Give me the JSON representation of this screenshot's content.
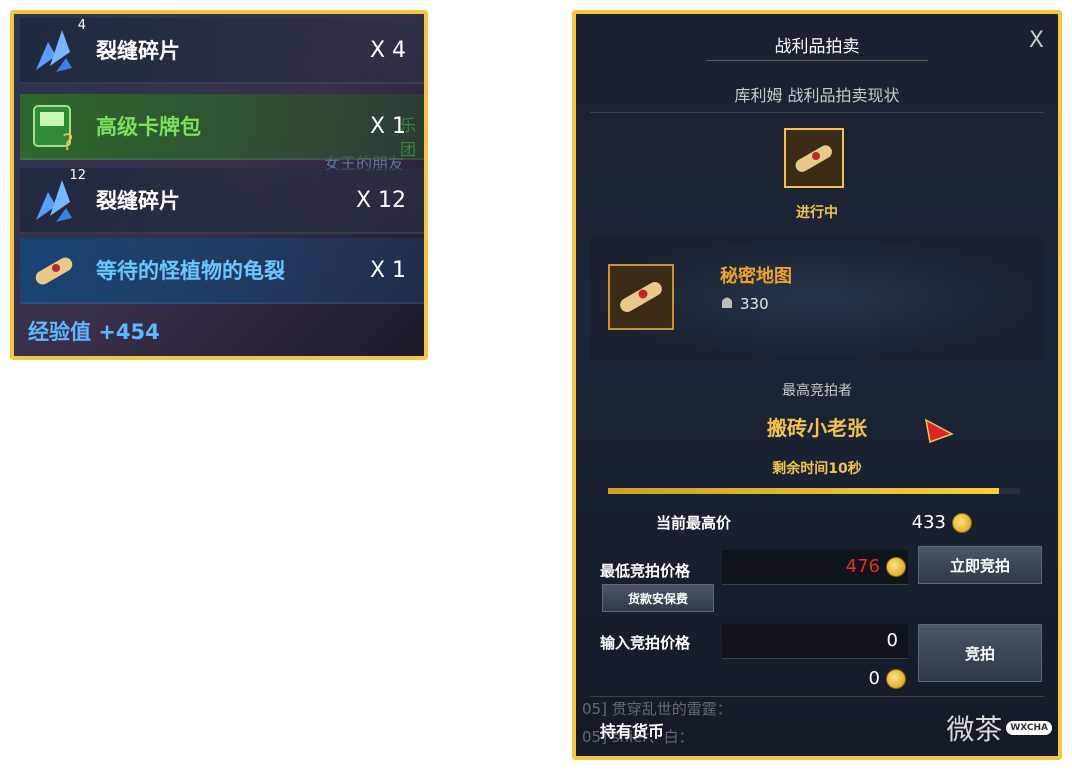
{
  "loot_panel": {
    "items": [
      {
        "name": "裂缝碎片",
        "qty": "X 4",
        "badge": "4",
        "color": "white"
      },
      {
        "name": "高级卡牌包",
        "qty": "X 1",
        "badge": "",
        "color": "green"
      },
      {
        "name": "裂缝碎片",
        "qty": "X 12",
        "badge": "12",
        "color": "white"
      },
      {
        "name": "等待的怪植物的龟裂",
        "qty": "X 1",
        "badge": "",
        "color": "blue"
      }
    ],
    "exp": "经验值 +454",
    "ghost_text_1": "乐团",
    "ghost_text_2": "女王的朋友"
  },
  "auction": {
    "title": "战利品拍卖",
    "close": "X",
    "subtitle": "库利姆 战利品拍卖现状",
    "status": "进行中",
    "item_name": "秘密地图",
    "item_power": "330",
    "highest_bidder_label": "最高竞拍者",
    "highest_bidder_name": "搬砖小老张",
    "time_left": "剩余时间10秒",
    "progress_fraction": 0.95,
    "current_highest_label": "当前最高价",
    "current_highest_value": "433",
    "min_bid_label": "最低竞拍价格",
    "min_bid_value": "476",
    "insurance_button": "货款安保费",
    "instant_bid_button": "立即竞拍",
    "input_bid_label": "输入竞拍价格",
    "input_bid_value": "0",
    "input_total_value": "0",
    "bid_button": "竞拍",
    "chat_line_1": "05] 贯穿乱世的雷霆：",
    "chat_line_2": "05] shier、白：",
    "holding_label": "持有货币",
    "watermark_text": "微茶",
    "watermark_badge": "WXCHA",
    "colors": {
      "gold": "#f2c34a",
      "orange": "#f0a326",
      "red": "#e0302c"
    }
  }
}
